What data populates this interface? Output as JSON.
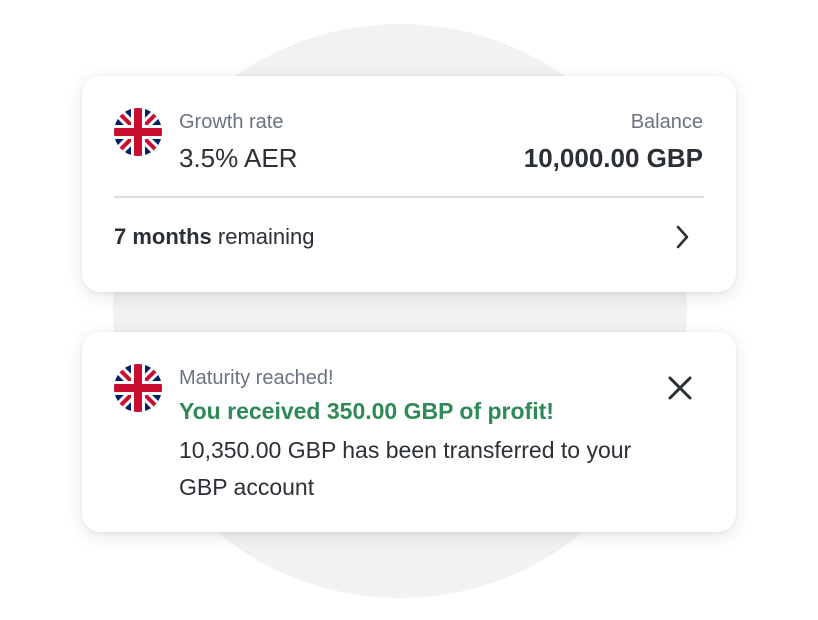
{
  "plan_card": {
    "flag_icon": "uk-flag-icon",
    "growth_rate_label": "Growth rate",
    "growth_rate_value": "3.5% AER",
    "balance_label": "Balance",
    "balance_value": "10,000.00 GBP",
    "remaining_bold": "7 months",
    "remaining_text": " remaining",
    "chevron_icon": "chevron-right-icon"
  },
  "notice_card": {
    "flag_icon": "uk-flag-icon",
    "title": "Maturity reached!",
    "profit_message": "You received 350.00 GBP of profit!",
    "transfer_message": "10,350.00 GBP has been transferred to your GBP account",
    "close_icon": "close-icon"
  },
  "colors": {
    "profit_green": "#2e8a57",
    "text_dark": "#2b2f36",
    "text_muted": "#6b7280",
    "background_circle": "#f2f2f3",
    "flag_red": "#c8102e",
    "flag_blue": "#012169"
  }
}
